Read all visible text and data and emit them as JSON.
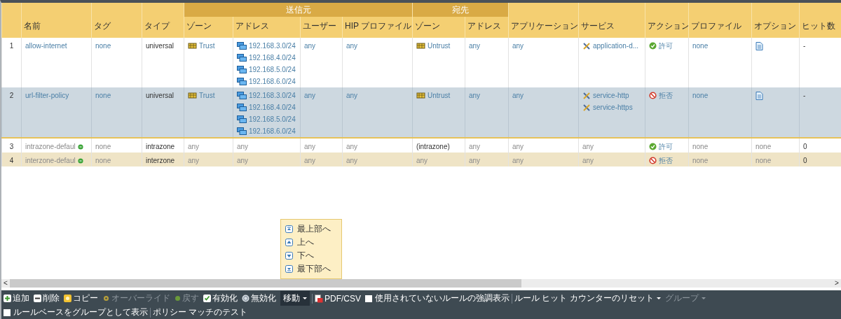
{
  "header": [
    {
      "label": "名前"
    },
    {
      "label": "タグ"
    },
    {
      "label": "タイプ"
    },
    {
      "label": "送信元",
      "children": [
        "ゾーン",
        "アドレス",
        "ユーザー",
        "HIP プロファイル"
      ]
    },
    {
      "label": "宛先",
      "children": [
        "ゾーン",
        "アドレス"
      ]
    },
    {
      "label": "アプリケーション"
    },
    {
      "label": "サービス"
    },
    {
      "label": "アクション"
    },
    {
      "label": "プロファイル"
    },
    {
      "label": "オプション"
    },
    {
      "label": "ヒット数"
    }
  ],
  "rows": [
    {
      "selected": false,
      "cells": [
        [
          {
            "kind": "plain",
            "text": "1"
          }
        ],
        [
          {
            "kind": "link",
            "text": "allow-internet"
          }
        ],
        [
          {
            "kind": "link",
            "text": "none"
          }
        ],
        [
          {
            "kind": "plain",
            "text": "universal"
          }
        ],
        [
          {
            "kind": "zone",
            "text": "Trust"
          }
        ],
        [
          {
            "kind": "address",
            "text": "192.168.3.0/24"
          },
          {
            "kind": "address",
            "text": "192.168.4.0/24"
          },
          {
            "kind": "address",
            "text": "192.168.5.0/24"
          },
          {
            "kind": "address",
            "text": "192.168.6.0/24"
          }
        ],
        [
          {
            "kind": "link",
            "text": "any"
          }
        ],
        [
          {
            "kind": "link",
            "text": "any"
          }
        ],
        [
          {
            "kind": "zone",
            "text": "Untrust"
          }
        ],
        [
          {
            "kind": "link",
            "text": "any"
          }
        ],
        [
          {
            "kind": "link",
            "text": "any"
          }
        ],
        [
          {
            "kind": "service",
            "text": "application-d..."
          }
        ],
        [
          {
            "kind": "allow",
            "text": "許可"
          }
        ],
        [
          {
            "kind": "link",
            "text": "none"
          }
        ],
        [
          {
            "kind": "options"
          }
        ],
        [
          {
            "kind": "plain",
            "text": "-"
          }
        ]
      ]
    },
    {
      "selected": true,
      "cells": [
        [
          {
            "kind": "plain",
            "text": "2"
          }
        ],
        [
          {
            "kind": "link",
            "text": "url-filter-policy"
          }
        ],
        [
          {
            "kind": "link",
            "text": "none"
          }
        ],
        [
          {
            "kind": "plain",
            "text": "universal"
          }
        ],
        [
          {
            "kind": "zone",
            "text": "Trust"
          }
        ],
        [
          {
            "kind": "address",
            "text": "192.168.3.0/24"
          },
          {
            "kind": "address",
            "text": "192.168.4.0/24"
          },
          {
            "kind": "address",
            "text": "192.168.5.0/24"
          },
          {
            "kind": "address",
            "text": "192.168.6.0/24"
          }
        ],
        [
          {
            "kind": "link",
            "text": "any"
          }
        ],
        [
          {
            "kind": "link",
            "text": "any"
          }
        ],
        [
          {
            "kind": "zone",
            "text": "Untrust"
          }
        ],
        [
          {
            "kind": "link",
            "text": "any"
          }
        ],
        [
          {
            "kind": "link",
            "text": "any"
          }
        ],
        [
          {
            "kind": "service",
            "text": "service-http"
          },
          {
            "kind": "service",
            "text": "service-https"
          }
        ],
        [
          {
            "kind": "deny",
            "text": "拒否"
          }
        ],
        [
          {
            "kind": "link",
            "text": "none"
          }
        ],
        [
          {
            "kind": "options"
          }
        ],
        [
          {
            "kind": "plain",
            "text": "-"
          }
        ]
      ]
    },
    {
      "selected": false,
      "cells": [
        [
          {
            "kind": "plain",
            "text": "3"
          }
        ],
        [
          {
            "kind": "default",
            "text": "intrazone-defaul"
          }
        ],
        [
          {
            "kind": "muted",
            "text": "none"
          }
        ],
        [
          {
            "kind": "plain",
            "text": "intrazone"
          }
        ],
        [
          {
            "kind": "muted",
            "text": "any"
          }
        ],
        [
          {
            "kind": "muted",
            "text": "any"
          }
        ],
        [
          {
            "kind": "muted",
            "text": "any"
          }
        ],
        [
          {
            "kind": "muted",
            "text": "any"
          }
        ],
        [
          {
            "kind": "plain",
            "text": "(intrazone)"
          }
        ],
        [
          {
            "kind": "muted",
            "text": "any"
          }
        ],
        [
          {
            "kind": "muted",
            "text": "any"
          }
        ],
        [
          {
            "kind": "muted",
            "text": "any"
          }
        ],
        [
          {
            "kind": "allow",
            "text": "許可"
          }
        ],
        [
          {
            "kind": "muted",
            "text": "none"
          }
        ],
        [
          {
            "kind": "muted",
            "text": "none"
          }
        ],
        [
          {
            "kind": "plain",
            "text": "0"
          }
        ]
      ]
    },
    {
      "selected": false,
      "cells": [
        [
          {
            "kind": "plain",
            "text": "4"
          }
        ],
        [
          {
            "kind": "default",
            "text": "interzone-defaul"
          }
        ],
        [
          {
            "kind": "muted",
            "text": "none"
          }
        ],
        [
          {
            "kind": "plain",
            "text": "interzone"
          }
        ],
        [
          {
            "kind": "muted",
            "text": "any"
          }
        ],
        [
          {
            "kind": "muted",
            "text": "any"
          }
        ],
        [
          {
            "kind": "muted",
            "text": "any"
          }
        ],
        [
          {
            "kind": "muted",
            "text": "any"
          }
        ],
        [
          {
            "kind": "muted",
            "text": "any"
          }
        ],
        [
          {
            "kind": "muted",
            "text": "any"
          }
        ],
        [
          {
            "kind": "muted",
            "text": "any"
          }
        ],
        [
          {
            "kind": "muted",
            "text": "any"
          }
        ],
        [
          {
            "kind": "deny",
            "text": "拒否"
          }
        ],
        [
          {
            "kind": "muted",
            "text": "none"
          }
        ],
        [
          {
            "kind": "muted",
            "text": "none"
          }
        ],
        [
          {
            "kind": "plain",
            "text": "0"
          }
        ]
      ]
    }
  ],
  "move_menu": [
    {
      "kind": "top",
      "label": "最上部へ"
    },
    {
      "kind": "up",
      "label": "上へ"
    },
    {
      "kind": "down",
      "label": "下へ"
    },
    {
      "kind": "bottom",
      "label": "最下部へ"
    }
  ],
  "scroll_left": "<",
  "scroll_right": ">",
  "toolbar": [
    {
      "kind": "add",
      "label": "追加",
      "disabled": false
    },
    {
      "kind": "delete",
      "label": "削除",
      "disabled": false
    },
    {
      "kind": "copy",
      "label": "コピー",
      "disabled": false
    },
    {
      "kind": "override",
      "label": "オーバーライド",
      "disabled": true
    },
    {
      "kind": "revert",
      "label": "戻す",
      "disabled": true
    },
    {
      "kind": "enable",
      "label": "有効化",
      "disabled": false
    },
    {
      "kind": "disable",
      "label": "無効化",
      "disabled": false
    },
    {
      "kind": "move",
      "label": "移動",
      "disabled": false
    },
    {
      "kind": "pdf",
      "label": "PDF/CSV",
      "disabled": false
    },
    {
      "kind": "checkbox",
      "label": "使用されていないルールの強調表示",
      "checked": false,
      "disabled": false
    },
    {
      "kind": "dropdown",
      "label": "ルール ヒット カウンターのリセット",
      "disabled": false
    },
    {
      "kind": "dropdown",
      "label": "グループ",
      "disabled": true
    },
    {
      "kind": "checkbox",
      "label": "ルールベースをグループとして表示",
      "checked": false,
      "disabled": false
    },
    {
      "kind": "text",
      "label": "ポリシー マッチのテスト",
      "disabled": false
    }
  ]
}
